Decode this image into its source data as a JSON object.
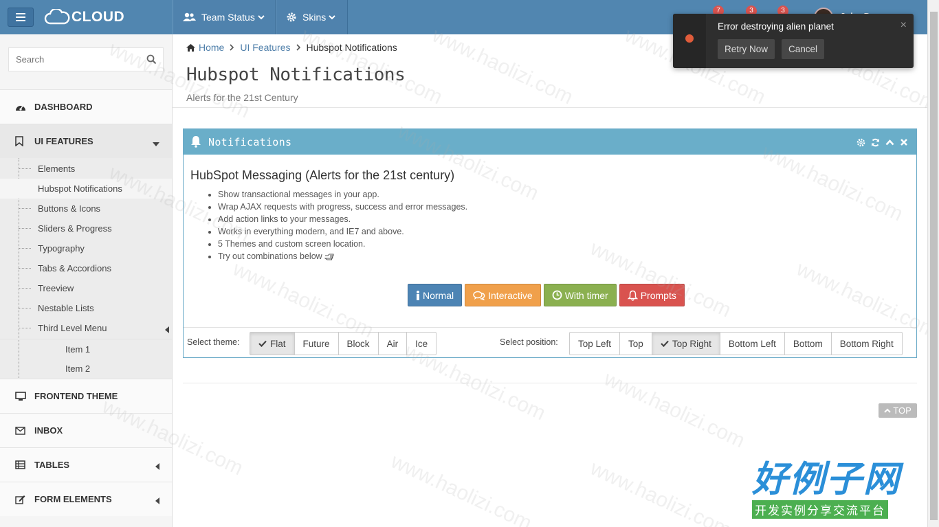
{
  "app": {
    "logo_text": "CLOUD",
    "username": "John Doe"
  },
  "topnav": {
    "team_status": "Team Status",
    "skins": "Skins",
    "badge1": "7",
    "badge2": "3",
    "badge3": "3"
  },
  "search": {
    "placeholder": "Search"
  },
  "sidebar": {
    "dashboard": "DASHBOARD",
    "ui_features": "UI FEATURES",
    "sub": [
      "Elements",
      "Hubspot Notifications",
      "Buttons & Icons",
      "Sliders & Progress",
      "Typography",
      "Tabs & Accordions",
      "Treeview",
      "Nestable Lists",
      "Third Level Menu"
    ],
    "third": [
      "Item 1",
      "Item 2"
    ],
    "frontend": "FRONTEND THEME",
    "inbox": "INBOX",
    "tables": "TABLES",
    "forms": "FORM ELEMENTS"
  },
  "breadcrumb": {
    "home": "Home",
    "ui": "UI Features",
    "current": "Hubspot Notifications"
  },
  "page": {
    "title": "Hubspot Notifications",
    "subtitle": "Alerts for the 21st Century"
  },
  "panel": {
    "title": "Notifications",
    "heading": "HubSpot Messaging (Alerts for the 21st century)",
    "features": [
      "Show transactional messages in your app.",
      "Wrap AJAX requests with progress, success and error messages.",
      "Add action links to your messages.",
      "Works in everything modern, and IE7 and above.",
      "5 Themes and custom screen location.",
      "Try out combinations below"
    ],
    "buttons": {
      "normal": "Normal",
      "interactive": "Interactive",
      "timer": "With timer",
      "prompts": "Prompts"
    },
    "theme_label": "Select theme:",
    "themes": [
      "Flat",
      "Future",
      "Block",
      "Air",
      "Ice"
    ],
    "position_label": "Select position:",
    "positions": [
      "Top Left",
      "Top",
      "Top Right",
      "Bottom Left",
      "Bottom",
      "Bottom Right"
    ]
  },
  "toast": {
    "message": "Error destroying alien planet",
    "retry": "Retry Now",
    "cancel": "Cancel",
    "close": "×"
  },
  "top_link": "TOP",
  "watermark": "www.haolizi.com",
  "brand": {
    "big": "好例子网",
    "small": "开发实例分享交流平台"
  },
  "colors": {
    "topbar": "#5186b0",
    "panel_head": "#6aaec9",
    "btn_normal": "#4d84b4",
    "btn_interactive": "#f0a04b",
    "btn_timer": "#8bb050",
    "btn_prompts": "#d9534f",
    "toast_bg": "#2e2e2e"
  }
}
